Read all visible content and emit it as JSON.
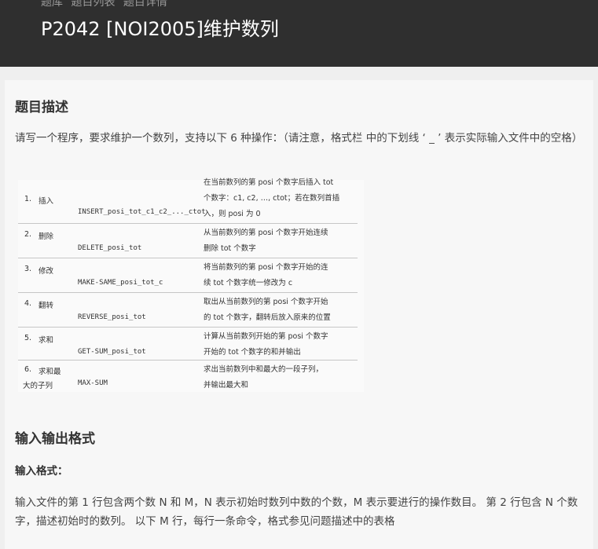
{
  "header": {
    "breadcrumb": [
      "题库",
      "题目列表",
      "题目详情"
    ],
    "title": "P2042 [NOI2005]维护数列"
  },
  "description": {
    "heading": "题目描述",
    "text": "请写一个程序，要求维护一个数列，支持以下 6 种操作：（请注意，格式栏 中的下划线 ‘ _ ’ 表示实际输入文件中的空格）"
  },
  "operations": [
    {
      "num": "1.",
      "name": "插入",
      "name2": "",
      "command": "INSERT_posi_tot_c1_c2_..._ctot",
      "desc": [
        "在当前数列的第 posi 个数字后插入 tot",
        "个数字：c1, c2, …, ctot；若在数列首插",
        "入，则 posi 为 0"
      ]
    },
    {
      "num": "2.",
      "name": "删除",
      "name2": "",
      "command": "DELETE_posi_tot",
      "desc": [
        "从当前数列的第 posi 个数字开始连续",
        "删除 tot 个数字"
      ]
    },
    {
      "num": "3.",
      "name": "修改",
      "name2": "",
      "command": "MAKE-SAME_posi_tot_c",
      "desc": [
        "将当前数列的第 posi 个数字开始的连",
        "续 tot 个数字统一修改为 c"
      ]
    },
    {
      "num": "4.",
      "name": "翻转",
      "name2": "",
      "command": "REVERSE_posi_tot",
      "desc": [
        "取出从当前数列的第 posi 个数字开始",
        "的 tot 个数字，翻转后放入原来的位置"
      ]
    },
    {
      "num": "5.",
      "name": "求和",
      "name2": "",
      "command": "GET-SUM_posi_tot",
      "desc": [
        "计算从当前数列开始的第 posi 个数字",
        "开始的 tot 个数字的和并输出"
      ]
    },
    {
      "num": "6.",
      "name": "求和最",
      "name2": "大的子列",
      "command": "MAX-SUM",
      "desc": [
        "求出当前数列中和最大的一段子列，",
        "并输出最大和"
      ]
    }
  ],
  "io": {
    "heading": "输入输出格式",
    "input_label": "输入格式：",
    "input_text": "输入文件的第 1 行包含两个数 N 和 M，N 表示初始时数列中数的个数，M 表示要进行的操作数目。 第 2 行包含 N 个数字，描述初始时的数列。 以下 M 行，每行一条命令，格式参见问题描述中的表格"
  }
}
